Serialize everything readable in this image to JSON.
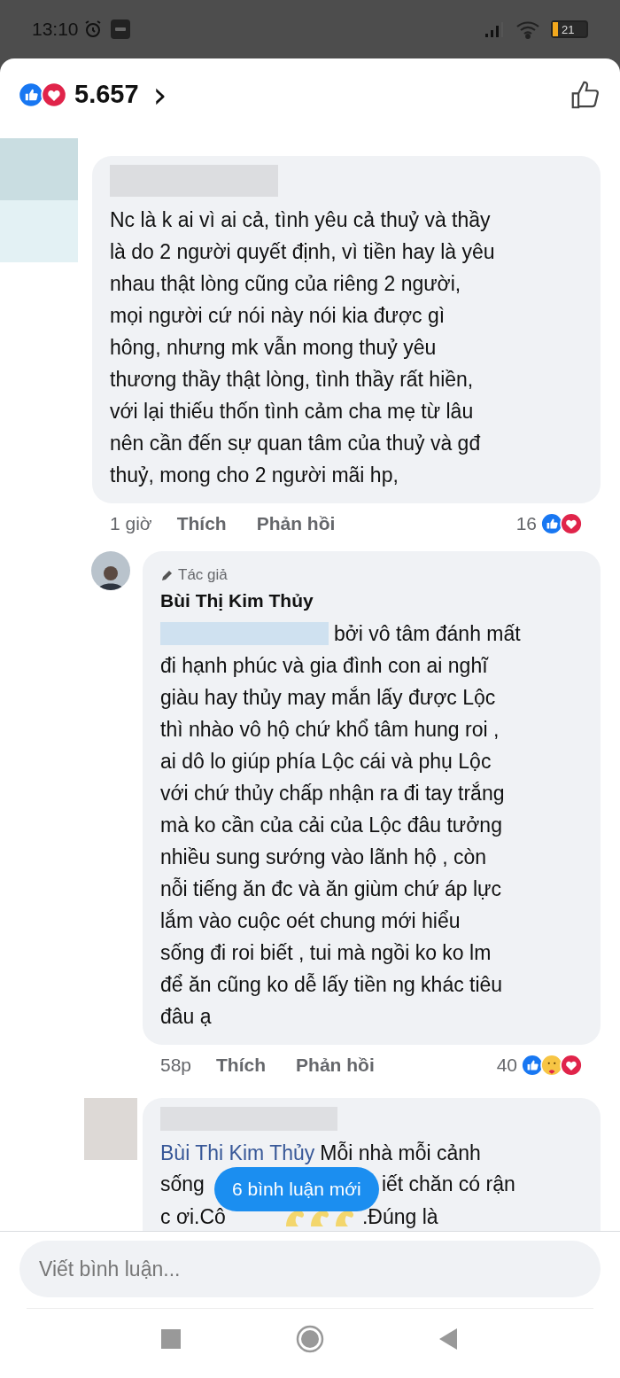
{
  "status_bar": {
    "time": "13:10",
    "battery": "21"
  },
  "reactions_header": {
    "count": "5.657",
    "chevron": "›"
  },
  "comments": [
    {
      "author_hidden": true,
      "lines": [
        "Nc là k ai vì ai cả, tình yêu cả thuỷ và thầy",
        "là do 2 người quyết định, vì tiền hay là yêu",
        "nhau thật lòng cũng của riêng 2 người,",
        "mọi người cứ nói này nói kia được gì",
        "hông, nhưng mk vẫn mong thuỷ yêu",
        "thương thầy thật lòng, tình thầy rất hiền,",
        "với lại thiếu thốn tình cảm cha mẹ từ lâu",
        "nên cần đến sự quan tâm của thuỷ và gđ",
        "thuỷ, mong cho 2 người mãi hp,"
      ],
      "time": "1 giờ",
      "like": "Thích",
      "reply": "Phản hồi",
      "reaction_count": "16",
      "reply_level": false
    },
    {
      "author_hidden": false,
      "author_badge": "Tác giả",
      "author": "Bùi Thị Kim Thủy",
      "lines": [
        "bởi vô tâm đánh mất",
        "đi hạnh phúc và gia đình con ai nghĩ",
        "giàu hay thủy may mắn lấy được Lộc",
        "thì nhào vô hộ chứ khổ tâm hung roi ,",
        "ai dô lo giúp phía Lộc cái và phụ Lộc",
        "với chứ thủy chấp nhận ra đi tay trắng",
        "mà ko cần của cải của Lộc đâu tưởng",
        "nhiều sung sướng vào lãnh hộ , còn",
        "nỗi tiếng ăn đc và ăn giùm chứ áp lực",
        "lắm vào cuộc oét chung mới hiểu",
        "sống đi roi biết , tui mà ngồi ko ko lm",
        "để ăn cũng ko dễ lấy tiền ng khác tiêu",
        "đâu ạ"
      ],
      "time": "58p",
      "like": "Thích",
      "reply": "Phản hồi",
      "reaction_count": "40",
      "reply_level": true
    }
  ],
  "partial_comment": {
    "mention": "Bùi Thi Kim Thủy",
    "line_1": "Mỗi nhà mỗi cảnh",
    "line_2_left": "sống",
    "line_2_right": "iết chăn  có rận",
    "line_3_left": "c ơi.Cô",
    "line_3_right": ".Đúng là"
  },
  "new_comments_pill": "6 bình luận mới",
  "composer": {
    "placeholder": "Viết bình luận..."
  }
}
